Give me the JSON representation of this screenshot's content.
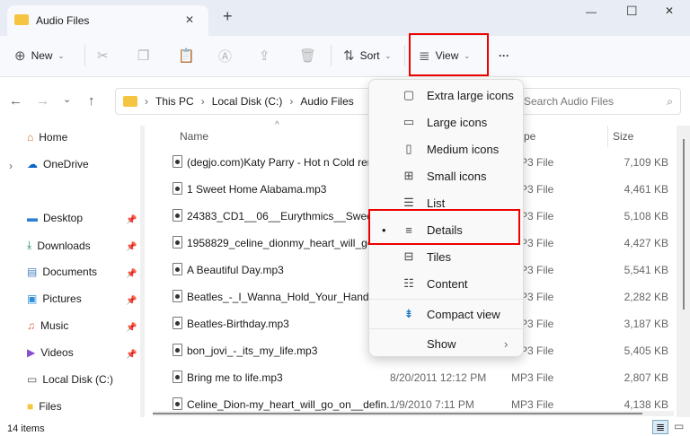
{
  "window": {
    "tab_title": "Audio Files",
    "new_tab": "+",
    "minimize": "—",
    "maximize": "☐",
    "close": "✕",
    "tab_close": "✕"
  },
  "toolbar": {
    "new": "New",
    "sort": "Sort",
    "view": "View",
    "more": "···"
  },
  "nav": {
    "breadcrumb": [
      "This PC",
      "Local Disk (C:)",
      "Audio Files"
    ],
    "search_placeholder": "Search Audio Files"
  },
  "sidebar": [
    "Home",
    "OneDrive",
    "Desktop",
    "Downloads",
    "Documents",
    "Pictures",
    "Music",
    "Videos",
    "Local Disk (C:)",
    "Files"
  ],
  "columns": {
    "name": "Name",
    "type_partial": "pe",
    "size": "Size"
  },
  "files": [
    {
      "name": "(degjo.com)Katy Parry - Hot n Cold rem",
      "date": "",
      "type": "MP3 File",
      "size": "7,109 KB"
    },
    {
      "name": "1 Sweet Home Alabama.mp3",
      "date": "",
      "type": "MP3 File",
      "size": "4,461 KB"
    },
    {
      "name": "24383_CD1__06__Eurythmics__Sweet_Dre",
      "date": "",
      "type": "MP3 File",
      "size": "5,108 KB"
    },
    {
      "name": "1958829_celine_dionmy_heart_will_go_on",
      "date": "",
      "type": "MP3 File",
      "size": "4,427 KB"
    },
    {
      "name": "A Beautiful Day.mp3",
      "date": "",
      "type": "MP3 File",
      "size": "5,541 KB"
    },
    {
      "name": "Beatles_-_I_Wanna_Hold_Your_Hand.mp",
      "date": "",
      "type": "MP3 File",
      "size": "2,282 KB"
    },
    {
      "name": "Beatles-Birthday.mp3",
      "date": "",
      "type": "MP3 File",
      "size": "3,187 KB"
    },
    {
      "name": "bon_jovi_-_its_my_life.mp3",
      "date": "",
      "type": "MP3 File",
      "size": "5,405 KB"
    },
    {
      "name": "Bring me to life.mp3",
      "date": "8/20/2011 12:12 PM",
      "type": "MP3 File",
      "size": "2,807 KB"
    },
    {
      "name": "Celine_Dion-my_heart_will_go_on__defin...",
      "date": "1/9/2010 7:11 PM",
      "type": "MP3 File",
      "size": "4,138 KB"
    }
  ],
  "view_menu": {
    "items": [
      "Extra large icons",
      "Large icons",
      "Medium icons",
      "Small icons",
      "List",
      "Details",
      "Tiles",
      "Content",
      "Compact view",
      "Show"
    ],
    "selected": "Details",
    "selected_mark": "•",
    "submenu_arrow": "›"
  },
  "status": {
    "count": "14 items"
  },
  "colors": {
    "highlight": "#e00000",
    "accent": "#0067c0"
  }
}
